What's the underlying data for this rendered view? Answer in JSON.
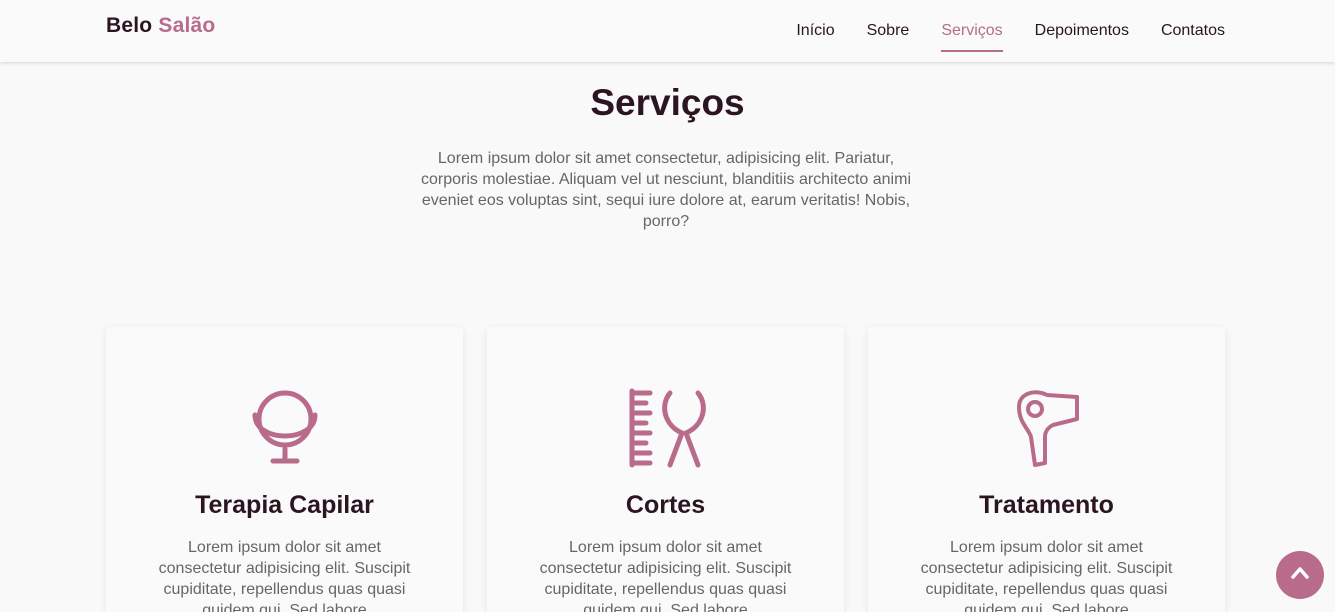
{
  "brand": {
    "first": "Belo",
    "second": "Salão"
  },
  "nav": [
    {
      "label": "Início",
      "active": false
    },
    {
      "label": "Sobre",
      "active": false
    },
    {
      "label": "Serviços",
      "active": true
    },
    {
      "label": "Depoimentos",
      "active": false
    },
    {
      "label": "Contatos",
      "active": false
    }
  ],
  "section": {
    "title": "Serviços",
    "description": "Lorem ipsum dolor sit amet consectetur, adipisicing elit. Pariatur, corporis molestiae. Aliquam vel ut nesciunt, blanditiis architecto animi eveniet eos voluptas sint, sequi iure dolore at, earum veritatis! Nobis, porro?"
  },
  "cards": [
    {
      "icon": "mirror-icon",
      "title": "Terapia Capilar",
      "text": "Lorem ipsum dolor sit amet consectetur adipisicing elit. Suscipit cupiditate, repellendus quas quasi quidem qui. Sed labore"
    },
    {
      "icon": "comb-scissors-icon",
      "title": "Cortes",
      "text": "Lorem ipsum dolor sit amet consectetur adipisicing elit. Suscipit cupiditate, repellendus quas quasi quidem qui. Sed labore"
    },
    {
      "icon": "hair-dryer-icon",
      "title": "Tratamento",
      "text": "Lorem ipsum dolor sit amet consectetur adipisicing elit. Suscipit cupiditate, repellendus quas quasi quidem qui. Sed labore"
    }
  ],
  "back_to_top": {
    "icon": "chevron-up-icon"
  },
  "colors": {
    "accent": "#b86b8a",
    "text": "#2a1520",
    "muted": "#6a6468",
    "background": "#f9f9f9"
  }
}
